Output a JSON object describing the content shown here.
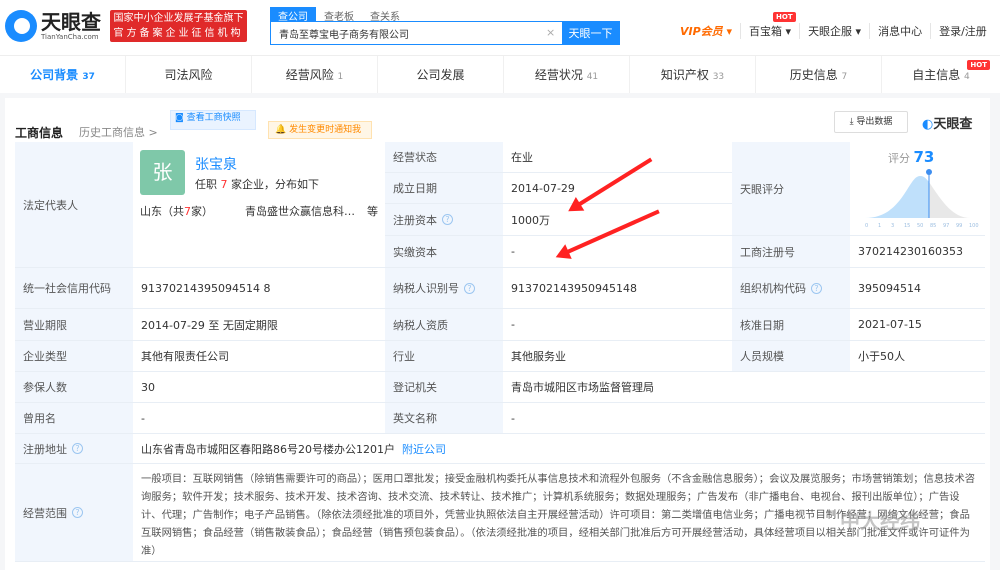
{
  "header": {
    "logo_cn": "天眼查",
    "logo_en": "TianYanCha.com",
    "badge_line1": "国家中小企业发展子基金旗下",
    "badge_line2": "官方备案企业征信机构",
    "search_tabs": [
      "查公司",
      "查老板",
      "查关系"
    ],
    "search_value": "青岛至尊宝电子商务有限公司",
    "search_button": "天眼一下",
    "nav": {
      "vip": "VIP会员 ▾",
      "baobaoxiang": "百宝箱 ▾",
      "qifu": "天眼企服 ▾",
      "messages": "消息中心",
      "login": "登录/注册",
      "hot": "HOT"
    }
  },
  "tabs": [
    {
      "label": "公司背景",
      "count": "37"
    },
    {
      "label": "司法风险",
      "count": ""
    },
    {
      "label": "经营风险",
      "count": "1"
    },
    {
      "label": "公司发展",
      "count": ""
    },
    {
      "label": "经营状况",
      "count": "41"
    },
    {
      "label": "知识产权",
      "count": "33"
    },
    {
      "label": "历史信息",
      "count": "7"
    },
    {
      "label": "自主信息",
      "count": "4"
    }
  ],
  "section": {
    "title": "工商信息",
    "history": "历史工商信息 >",
    "snapshot": "查看工商快照",
    "notify": "发生变更时通知我",
    "export": "导出数据",
    "brand": "天眼查"
  },
  "legal_rep": {
    "label": "法定代表人",
    "avatar": "张",
    "name": "张宝泉",
    "desc_pre": "任职",
    "count": "7",
    "desc_post": "家企业，分布如下",
    "region_pre": "山东（共",
    "region_count": "7",
    "region_post": "家）",
    "company": "青岛盛世众赢信息科…",
    "etc": "等"
  },
  "fields": {
    "status": {
      "label": "经营状态",
      "value": "在业"
    },
    "founded": {
      "label": "成立日期",
      "value": "2014-07-29"
    },
    "reg_capital": {
      "label": "注册资本",
      "value": "1000万"
    },
    "paid_capital": {
      "label": "实缴资本",
      "value": "-"
    },
    "score": {
      "label": "天眼评分",
      "title": "评分",
      "value": "73",
      "ticks": [
        "0",
        "1",
        "3",
        "15",
        "50",
        "85",
        "97",
        "99",
        "100"
      ]
    },
    "reg_no": {
      "label": "工商注册号",
      "value": "370214230160353"
    },
    "credit_code": {
      "label": "统一社会信用代码",
      "value": "91370214395094514 8"
    },
    "taxpayer_id": {
      "label": "纳税人识别号",
      "value": "913702143950945148"
    },
    "org_code": {
      "label": "组织机构代码",
      "value": "395094514"
    },
    "term": {
      "label": "营业期限",
      "value": "2014-07-29 至 无固定期限"
    },
    "taxpayer_type": {
      "label": "纳税人资质",
      "value": "-"
    },
    "approved": {
      "label": "核准日期",
      "value": "2021-07-15"
    },
    "company_type": {
      "label": "企业类型",
      "value": "其他有限责任公司"
    },
    "industry": {
      "label": "行业",
      "value": "其他服务业"
    },
    "staff": {
      "label": "人员规模",
      "value": "小于50人"
    },
    "insured": {
      "label": "参保人数",
      "value": "30"
    },
    "authority": {
      "label": "登记机关",
      "value": "青岛市城阳区市场监督管理局"
    },
    "former_name": {
      "label": "曾用名",
      "value": "-"
    },
    "english_name": {
      "label": "英文名称",
      "value": "-"
    },
    "address": {
      "label": "注册地址",
      "value": "山东省青岛市城阳区春阳路86号20号楼办公1201户",
      "link": "附近公司"
    },
    "scope": {
      "label": "经营范围",
      "value": "一般项目：互联网销售（除销售需要许可的商品）；医用口罩批发；接受金融机构委托从事信息技术和流程外包服务（不含金融信息服务）；会议及展览服务；市场营销策划；信息技术咨询服务；软件开发；技术服务、技术开发、技术咨询、技术交流、技术转让、技术推广；计算机系统服务；数据处理服务；广告发布（非广播电台、电视台、报刊出版单位）；广告设计、代理；广告制作；电子产品销售。（除依法须经批准的项目外，凭营业执照依法自主开展经营活动）许可项目：第二类增值电信业务；广播电视节目制作经营；网络文化经营；食品互联网销售；食品经营（销售散装食品）；食品经营（销售预包装食品）。（依法须经批准的项目，经相关部门批准后方可开展经营活动，具体经营项目以相关部门批准文件或许可证件为准）"
    }
  },
  "watermark": "中大经纬"
}
